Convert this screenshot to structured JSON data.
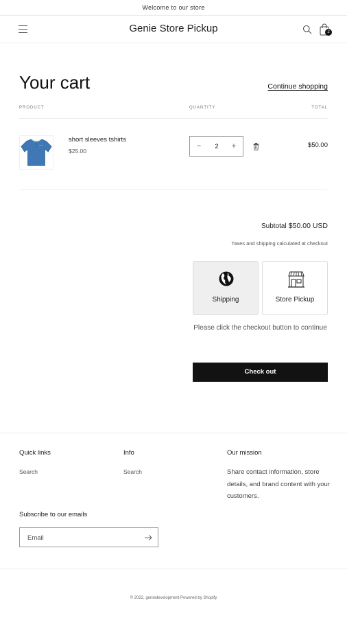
{
  "announcement": "Welcome to our store",
  "header": {
    "title": "Genie Store Pickup",
    "cart_count": "2"
  },
  "cart": {
    "title": "Your cart",
    "continue_label": "Continue shopping",
    "columns": {
      "product": "PRODUCT",
      "quantity": "QUANTITY",
      "total": "TOTAL"
    },
    "items": [
      {
        "name": "short sleeves tshirts",
        "price": "$25.00",
        "quantity": "2",
        "total": "$50.00",
        "image": "blue-polo-shirt"
      }
    ],
    "subtotal_label": "Subtotal",
    "subtotal_value": "$50.00 USD",
    "tax_note": "Taxes and shipping calculated at checkout",
    "delivery_options": [
      {
        "label": "Shipping",
        "icon": "globe-icon",
        "selected": true
      },
      {
        "label": "Store Pickup",
        "icon": "store-icon",
        "selected": false
      }
    ],
    "checkout_message": "Please click the checkout button to continue",
    "checkout_label": "Check out"
  },
  "footer": {
    "columns": [
      {
        "heading": "Quick links",
        "links": [
          "Search"
        ]
      },
      {
        "heading": "Info",
        "links": [
          "Search"
        ]
      },
      {
        "heading": "Our mission",
        "text": "Share contact information, store details, and brand content with your customers."
      }
    ],
    "subscribe_heading": "Subscribe to our emails",
    "email_placeholder": "Email",
    "copyright": "© 2022, geniedevelopment Powered by Shopify"
  },
  "colors": {
    "primary": "#121212",
    "selected_card": "#efefef",
    "border": "#ececec"
  }
}
